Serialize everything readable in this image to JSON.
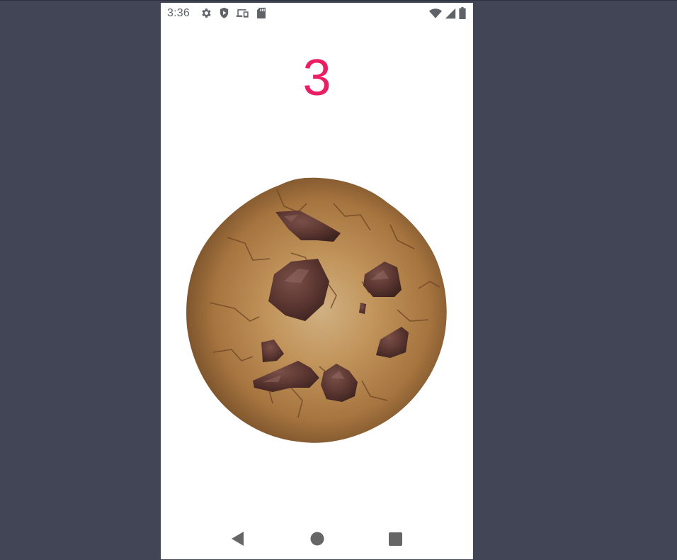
{
  "status_bar": {
    "time": "3:36",
    "left_icons": [
      "settings-icon",
      "play-protect-icon",
      "devices-icon",
      "sd-card-icon"
    ],
    "right_icons": [
      "wifi-icon",
      "cellular-signal-icon",
      "battery-icon"
    ]
  },
  "game": {
    "click_count": "3",
    "counter_color": "#e91e63",
    "cookie_image": "cookie-icon"
  },
  "nav_bar": {
    "buttons": [
      "back-icon",
      "home-icon",
      "recents-icon"
    ]
  },
  "colors": {
    "background": "#424556",
    "screen": "#ffffff",
    "icon_gray": "#5f6368",
    "nav_gray": "#666666"
  }
}
